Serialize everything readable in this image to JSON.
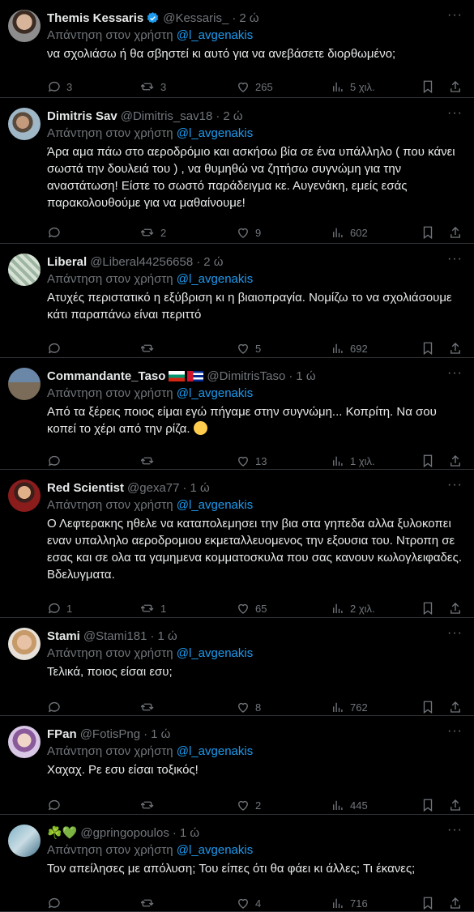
{
  "reply_prefix": "Απάντηση στον χρήστη",
  "reply_target": "@l_avgenakis",
  "tweets": [
    {
      "name": "Themis Kessaris",
      "handle": "@Kessaris_",
      "time": "2 ώ",
      "text": "να σχολιάσω ή θα σβηστεί κι αυτό για να ανεβάσετε διορθωμένο;",
      "replies": "3",
      "retweets": "3",
      "likes": "265",
      "views": "5 χιλ."
    },
    {
      "name": "Dimitris Sav",
      "handle": "@Dimitris_sav18",
      "time": "2 ώ",
      "text": "Άρα αμα πάω στο αεροδρόμιο και ασκήσω βία σε ένα υπάλληλο ( που κάνει σωστά την δουλειά του ) , να θυμηθώ να ζητήσω συγνώμη για την αναστάτωση! Είστε το σωστό παράδειγμα κε. Αυγενάκη, εμείς εσάς παρακολουθούμε για να μαθαίνουμε!",
      "replies": "",
      "retweets": "2",
      "likes": "9",
      "views": "602"
    },
    {
      "name": "Liberal",
      "handle": "@Liberal44256658",
      "time": "2 ώ",
      "text": "Ατυχές περιστατικό η εξύβριση κι η βιαιοπραγία. Νομίζω το να σχολιάσουμε κάτι παραπάνω είναι περιττό",
      "replies": "",
      "retweets": "",
      "likes": "5",
      "views": "692"
    },
    {
      "name": "Commandante_Taso",
      "handle": "@DimitrisTaso",
      "time": "1 ώ",
      "text": "Από τα ξέρεις ποιος είμαι εγώ πήγαμε στην συγνώμη... Κοπρίτη. Να σου κοπεί το χέρι από την ρίζα.",
      "replies": "",
      "retweets": "",
      "likes": "13",
      "views": "1 χιλ."
    },
    {
      "name": "Red Scientist",
      "handle": "@gexa77",
      "time": "1 ώ",
      "text": "Ο Λεφτερακης ηθελε να καταπολεμησει την βια στα γηπεδα αλλα ξυλοκοπει εναν υπαλληλο αεροδρομιου εκμεταλλευομενος την εξουσια του. Ντροπη σε εσας και σε ολα τα γαμημενα κομματοσκυλα που σας κανουν κωλογλειφαδες. Βδελυγματα.",
      "replies": "1",
      "retweets": "1",
      "likes": "65",
      "views": "2 χιλ."
    },
    {
      "name": "Stami",
      "handle": "@Stami181",
      "time": "1 ώ",
      "text": "Τελικά, ποιος είσαι εσυ;",
      "replies": "",
      "retweets": "",
      "likes": "8",
      "views": "762"
    },
    {
      "name": "FPan",
      "handle": "@FotisPng",
      "time": "1 ώ",
      "text": "Χαχαχ. Ρε εσυ είσαι τοξικός!",
      "replies": "",
      "retweets": "",
      "likes": "2",
      "views": "445"
    },
    {
      "name": "☘️💚",
      "handle": "@gpringopoulos",
      "time": "1 ώ",
      "text": "Τον απείλησες με απόλυση; Του είπες ότι θα φάει κι άλλες; Τι έκανες;",
      "replies": "",
      "retweets": "",
      "likes": "4",
      "views": "716"
    }
  ],
  "colors": {
    "background": "#000000",
    "text": "#e7e9ea",
    "muted": "#71767b",
    "link": "#1d9bf0",
    "divider": "#2f3336"
  },
  "icons": [
    "reply-icon",
    "retweet-icon",
    "like-icon",
    "views-icon",
    "bookmark-icon",
    "share-icon",
    "verified-icon",
    "more-icon"
  ]
}
